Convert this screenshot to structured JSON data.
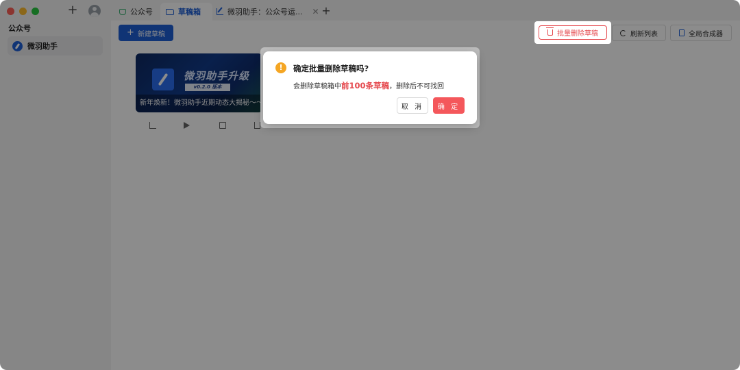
{
  "sidebar": {
    "heading": "公众号",
    "account": {
      "label": "微羽助手"
    }
  },
  "tabs": [
    {
      "label": "公众号",
      "icon": "recycle-icon"
    },
    {
      "label": "草稿箱",
      "icon": "folder-icon"
    },
    {
      "label": "微羽助手：公众号运...",
      "icon": "edit-icon"
    }
  ],
  "toolbar": {
    "new_draft": "新建草稿",
    "batch_delete": "批量删除草稿",
    "refresh": "刷新列表",
    "global_composer": "全局合成器"
  },
  "draft_card": {
    "cover_title": "微羽助手升级",
    "cover_version": "v0.2.0 版本",
    "caption": "新年焕新！微羽助手近期动态大揭秘～～"
  },
  "dialog": {
    "title": "确定批量删除草稿吗?",
    "message_prefix": "会删除草稿箱中",
    "message_highlight": "前100条草稿",
    "message_suffix": "，删除后不可找回",
    "cancel": "取 消",
    "confirm": "确 定"
  },
  "colors": {
    "accent": "#1e5fd6",
    "danger": "#f4575b",
    "warning": "#f5a623"
  }
}
